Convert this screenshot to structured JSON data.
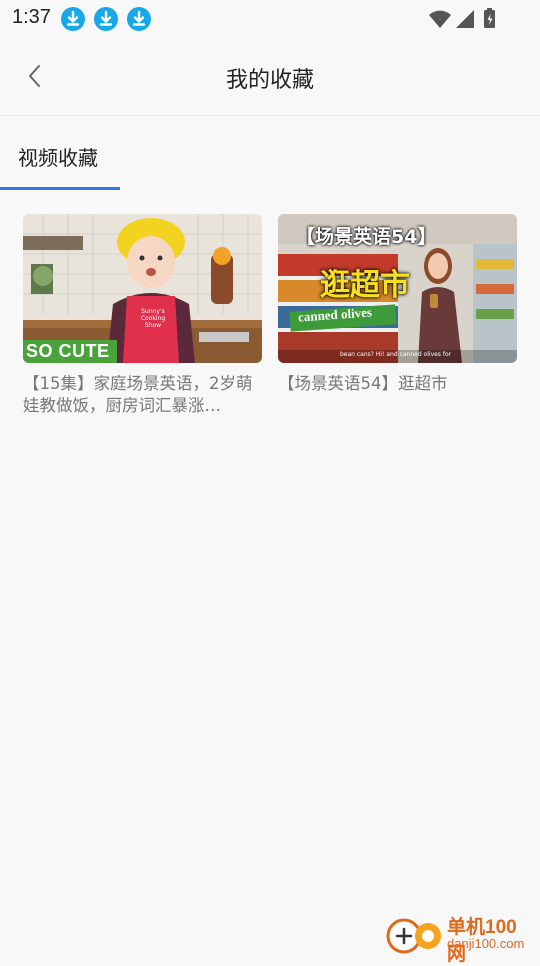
{
  "status_bar": {
    "time": "1:37"
  },
  "header": {
    "title": "我的收藏"
  },
  "tabs": [
    {
      "label": "视频收藏",
      "active": true
    }
  ],
  "accent_color": "#2d7be8",
  "videos": [
    {
      "title": "【15集】家庭场景英语，2岁萌娃教做饭，厨房词汇暴涨…",
      "badge": "SO CUTE",
      "apron_text": "Sunny's Cooking Show"
    },
    {
      "title": "【场景英语54】逛超市",
      "thumb_title": "【场景英语54】",
      "thumb_heading": "逛超市",
      "thumb_label": "canned olives",
      "thumb_caption": "bean cans? Hi! and canned olives for"
    }
  ],
  "watermark": {
    "brand": "单机100网",
    "domain": "danji100.com"
  }
}
